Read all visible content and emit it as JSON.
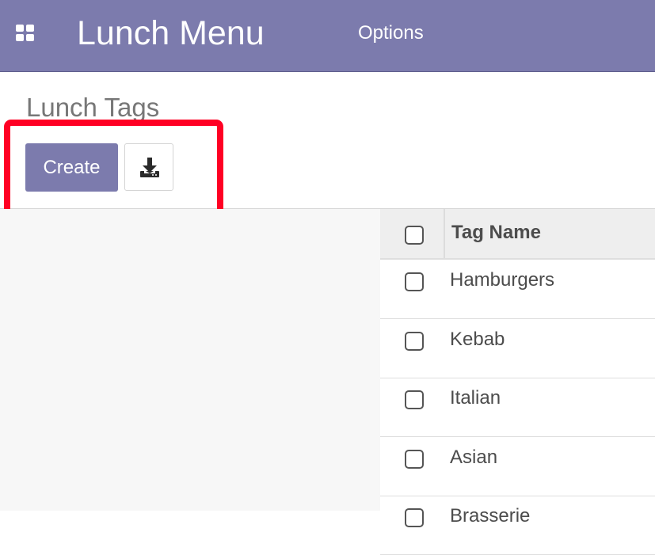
{
  "header": {
    "app_title": "Lunch Menu",
    "menu_options": "Options"
  },
  "control_panel": {
    "breadcrumb": "Lunch Tags",
    "create_label": "Create",
    "download_icon": "download-icon"
  },
  "list": {
    "column_header": "Tag Name",
    "rows": [
      "Hamburgers",
      "Kebab",
      "Italian",
      "Asian",
      "Brasserie"
    ]
  },
  "colors": {
    "brand": "#7c7bad",
    "highlight": "#ff0024"
  }
}
